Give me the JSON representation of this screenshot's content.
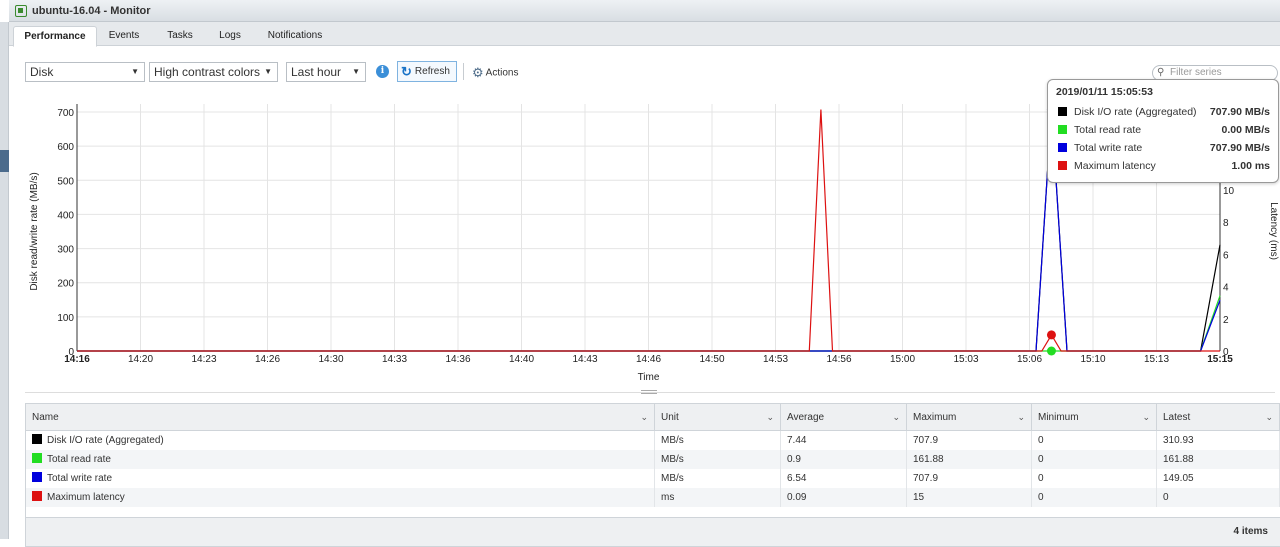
{
  "window": {
    "title": "ubuntu-16.04 - Monitor"
  },
  "tabs": [
    {
      "label": "Performance",
      "active": true
    },
    {
      "label": "Events",
      "active": false
    },
    {
      "label": "Tasks",
      "active": false
    },
    {
      "label": "Logs",
      "active": false
    },
    {
      "label": "Notifications",
      "active": false
    }
  ],
  "toolbar": {
    "metric_select": "Disk",
    "color_select": "High contrast colors",
    "range_select": "Last hour",
    "refresh_label": "Refresh",
    "actions_label": "Actions",
    "filter_placeholder": "Filter series"
  },
  "tooltip": {
    "timestamp": "2019/01/11 15:05:53",
    "rows": [
      {
        "name": "Disk I/O rate (Aggregated)",
        "value": "707.90 MB/s",
        "color": "#000000"
      },
      {
        "name": "Total read rate",
        "value": "0.00 MB/s",
        "color": "#22dd22"
      },
      {
        "name": "Total write rate",
        "value": "707.90 MB/s",
        "color": "#0000dd"
      },
      {
        "name": "Maximum latency",
        "value": "1.00 ms",
        "color": "#dd1111"
      }
    ]
  },
  "chart_data": {
    "type": "line",
    "xlabel": "Time",
    "ylabel": "Disk read/write rate (MB/s)",
    "y2label": "Latency (ms)",
    "ylim": [
      0,
      700
    ],
    "y2lim": [
      0,
      15
    ],
    "yticks": [
      "0",
      "100",
      "200",
      "300",
      "400",
      "500",
      "600",
      "700"
    ],
    "y2ticks": [
      "0",
      "2",
      "4",
      "6",
      "8",
      "10"
    ],
    "xticks": [
      "14:16",
      "14:20",
      "14:23",
      "14:26",
      "14:30",
      "14:33",
      "14:36",
      "14:40",
      "14:43",
      "14:46",
      "14:50",
      "14:53",
      "14:56",
      "15:00",
      "15:03",
      "15:06",
      "15:10",
      "15:13",
      "15:15"
    ],
    "x_range_minutes": [
      0,
      59
    ],
    "grid": true,
    "series": [
      {
        "name": "Disk I/O rate (Aggregated)",
        "axis": "left",
        "color": "#000000",
        "points": [
          [
            0,
            0
          ],
          [
            49.5,
            0
          ],
          [
            50.3,
            707.9
          ],
          [
            51.1,
            0
          ],
          [
            58.0,
            0
          ],
          [
            59,
            310.93
          ]
        ]
      },
      {
        "name": "Total read rate",
        "axis": "left",
        "color": "#22dd22",
        "points": [
          [
            0,
            0
          ],
          [
            49.5,
            0
          ],
          [
            50.3,
            0
          ],
          [
            51.1,
            0
          ],
          [
            58.0,
            0
          ],
          [
            59,
            161.88
          ]
        ]
      },
      {
        "name": "Total write rate",
        "axis": "left",
        "color": "#0000dd",
        "points": [
          [
            0,
            0
          ],
          [
            49.5,
            0
          ],
          [
            50.3,
            707.9
          ],
          [
            51.1,
            0
          ],
          [
            58.0,
            0
          ],
          [
            59,
            149.05
          ]
        ]
      },
      {
        "name": "Maximum latency",
        "axis": "right",
        "color": "#dd1111",
        "points": [
          [
            0,
            0
          ],
          [
            37.8,
            0
          ],
          [
            38.4,
            15
          ],
          [
            39.0,
            0
          ],
          [
            49.8,
            0
          ],
          [
            50.3,
            1
          ],
          [
            50.8,
            0
          ],
          [
            59,
            0
          ]
        ]
      }
    ],
    "highlight_x": 50.3
  },
  "table": {
    "columns": [
      "Name",
      "Unit",
      "Average",
      "Maximum",
      "Minimum",
      "Latest"
    ],
    "rows": [
      {
        "color": "#000000",
        "cells": [
          "Disk I/O rate (Aggregated)",
          "MB/s",
          "7.44",
          "707.9",
          "0",
          "310.93"
        ]
      },
      {
        "color": "#22dd22",
        "cells": [
          "Total read rate",
          "MB/s",
          "0.9",
          "161.88",
          "0",
          "161.88"
        ]
      },
      {
        "color": "#0000dd",
        "cells": [
          "Total write rate",
          "MB/s",
          "6.54",
          "707.9",
          "0",
          "149.05"
        ]
      },
      {
        "color": "#dd1111",
        "cells": [
          "Maximum latency",
          "ms",
          "0.09",
          "15",
          "0",
          "0"
        ]
      }
    ],
    "footer": "4 items"
  }
}
